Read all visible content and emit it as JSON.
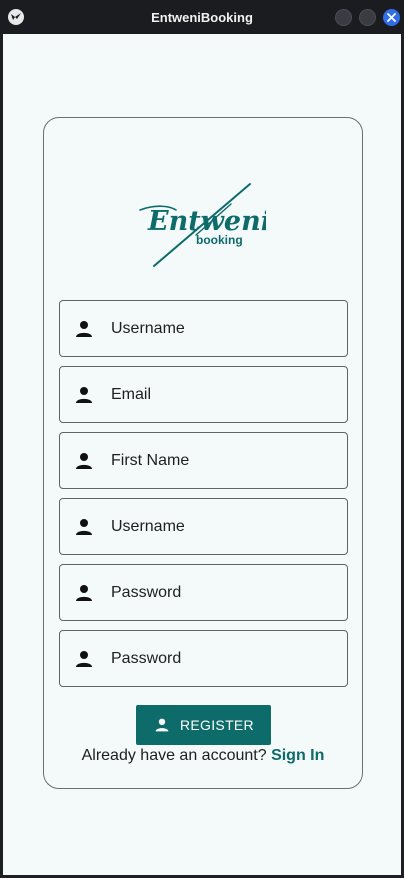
{
  "window": {
    "title": "EntweniBooking",
    "app_icon": "kivy-logo-icon",
    "controls": [
      "minimize",
      "maximize",
      "close"
    ]
  },
  "logo": {
    "script_text": "Entweni",
    "sub_text": "booking",
    "color": "#0d6b6a"
  },
  "form": {
    "fields": [
      {
        "placeholder": "Username",
        "icon": "person-icon"
      },
      {
        "placeholder": "Email",
        "icon": "person-icon"
      },
      {
        "placeholder": "First Name",
        "icon": "person-icon"
      },
      {
        "placeholder": "Username",
        "icon": "person-icon"
      },
      {
        "placeholder": "Password",
        "icon": "person-icon"
      },
      {
        "placeholder": "Password",
        "icon": "person-icon"
      }
    ],
    "register_label": "REGISTER",
    "register_icon": "person-icon",
    "signin_prompt": "Already have an account?",
    "signin_link": "Sign In"
  },
  "colors": {
    "accent": "#0d6b6a",
    "background": "#f4f9fa",
    "close_button": "#2f6ee8"
  }
}
